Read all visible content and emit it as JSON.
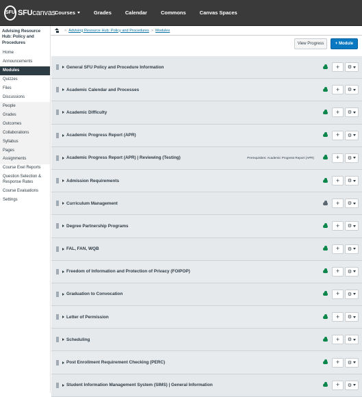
{
  "logo": {
    "text_bold": "SFU",
    "text_light": "canvas",
    "circle": "SFU"
  },
  "topnav": [
    {
      "label": "Courses",
      "dropdown": true
    },
    {
      "label": "Grades",
      "dropdown": false
    },
    {
      "label": "Calendar",
      "dropdown": false
    },
    {
      "label": "Commons",
      "dropdown": false
    },
    {
      "label": "Canvas Spaces",
      "dropdown": false
    }
  ],
  "course_title": "Advising Resource Hub: Policy and Procedures",
  "sidenav": [
    {
      "label": "Home",
      "active": false
    },
    {
      "label": "Announcements",
      "active": false
    },
    {
      "label": "Modules",
      "active": true
    },
    {
      "label": "Quizzes",
      "active": false
    },
    {
      "label": "Files",
      "active": false
    },
    {
      "label": "Discussions",
      "active": false
    },
    {
      "label": "People",
      "active": false
    },
    {
      "label": "Grades",
      "active": false
    },
    {
      "label": "Outcomes",
      "active": false
    },
    {
      "label": "Collaborations",
      "active": false
    },
    {
      "label": "Syllabus",
      "active": false
    },
    {
      "label": "Pages",
      "active": false
    },
    {
      "label": "Assignments",
      "active": false
    },
    {
      "label": "Course Exel Reports",
      "active": false
    },
    {
      "label": "Question Selection & Response Rates",
      "active": false
    },
    {
      "label": "Course Evaluations",
      "active": false
    },
    {
      "label": "Settings",
      "active": false
    }
  ],
  "breadcrumb": {
    "course": "Advising Resource Hub: Policy and Procedures",
    "separator": ">",
    "current": "Modules"
  },
  "toolbar": {
    "view_progress": "View Progress",
    "add_module": "+ Module"
  },
  "modules": [
    {
      "title": "General SFU Policy and Procedure Information",
      "prereq": "",
      "published": true
    },
    {
      "title": "Academic Calendar and Processes",
      "prereq": "",
      "published": true
    },
    {
      "title": "Academic Difficulty",
      "prereq": "",
      "published": true
    },
    {
      "title": "Academic Progress Report (APR)",
      "prereq": "",
      "published": true
    },
    {
      "title": "Academic Progress Report (APR) | Reviewing (Testing)",
      "prereq": "Prerequisites: Academic Progress Report (APR)",
      "published": true
    },
    {
      "title": "Admission Requirements",
      "prereq": "",
      "published": true
    },
    {
      "title": "Curriculum Management",
      "prereq": "",
      "published": false
    },
    {
      "title": "Degree Partnership Programs",
      "prereq": "",
      "published": true
    },
    {
      "title": "FAL, FAN, WQB",
      "prereq": "",
      "published": true
    },
    {
      "title": "Freedom of Information and Protection of Privacy (FOIPOP)",
      "prereq": "",
      "published": true
    },
    {
      "title": "Graduation to Convocation",
      "prereq": "",
      "published": true
    },
    {
      "title": "Letter of Permission",
      "prereq": "",
      "published": true
    },
    {
      "title": "Scheduling",
      "prereq": "",
      "published": true
    },
    {
      "title": "Post Enrollment Requirement Checking (PERC)",
      "prereq": "",
      "published": true
    },
    {
      "title": "Student Information Management System (SIMS) | General Information",
      "prereq": "",
      "published": true
    }
  ],
  "icons": {
    "plus": "+",
    "gear": "⚙"
  }
}
